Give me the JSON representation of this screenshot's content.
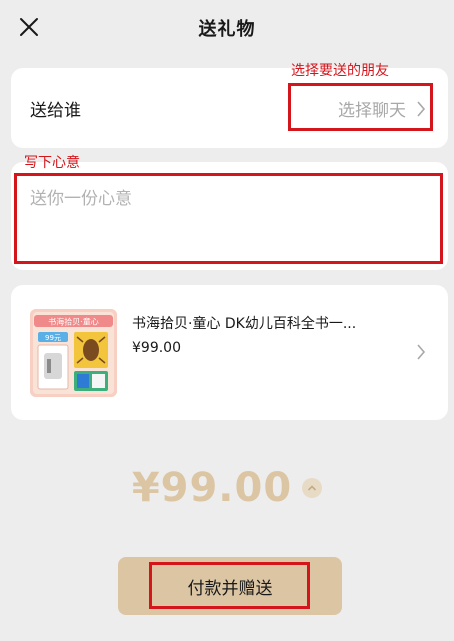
{
  "header": {
    "title": "送礼物",
    "close_icon": "close-icon"
  },
  "recipient": {
    "label": "送给谁",
    "picker_text": "选择聊天",
    "chevron_icon": "chevron-right-icon"
  },
  "message": {
    "placeholder": "送你一份心意",
    "value": ""
  },
  "product": {
    "name": "书海拾贝·童心 DK幼儿百科全书一...",
    "price": "¥99.00",
    "thumb_title": "书海拾贝·童心",
    "thumb_label": "99元",
    "chevron_icon": "chevron-right-icon"
  },
  "total": {
    "amount": "¥99.00",
    "toggle_icon": "chevron-up-icon"
  },
  "pay_button": {
    "label": "付款并赠送"
  },
  "annotations": {
    "choose_friend": "选择要送的朋友",
    "write_message": "写下心意"
  },
  "colors": {
    "accent": "#dcc5a3",
    "annotation": "#d4161c",
    "background": "#ededed"
  }
}
